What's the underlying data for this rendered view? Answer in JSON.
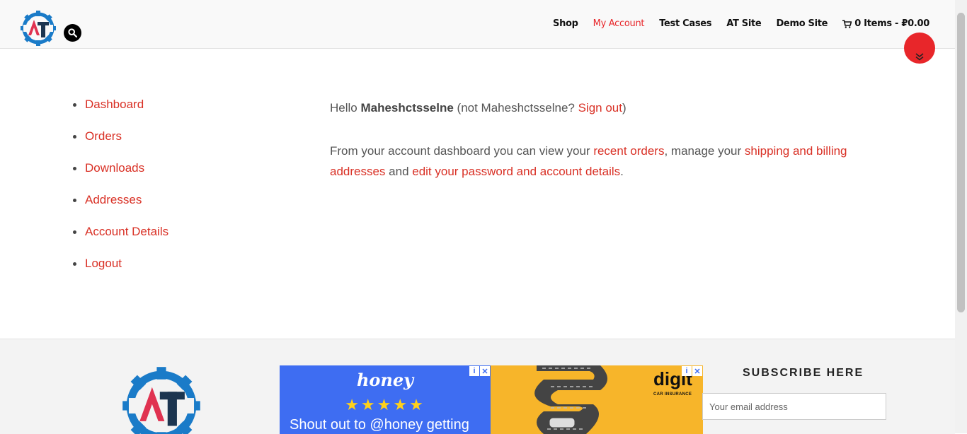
{
  "header": {
    "nav": [
      {
        "label": "Shop",
        "active": false
      },
      {
        "label": "My Account",
        "active": true
      },
      {
        "label": "Test Cases",
        "active": false
      },
      {
        "label": "AT Site",
        "active": false
      },
      {
        "label": "Demo Site",
        "active": false
      }
    ],
    "cart_label": "0 Items - ₽0.00"
  },
  "account_nav": {
    "items": [
      "Dashboard",
      "Orders",
      "Downloads",
      "Addresses",
      "Account Details",
      "Logout"
    ]
  },
  "dashboard": {
    "hello_prefix": "Hello ",
    "username": "Maheshctsselne",
    "not_prefix": " (not Maheshctsselne? ",
    "sign_out": "Sign out",
    "close_paren": ")",
    "intro": "From your account dashboard you can view your ",
    "recent_orders": "recent orders",
    "manage": ", manage your ",
    "shipping_billing": "shipping and billing addresses",
    "and": " and ",
    "edit_account": "edit your password and account details",
    "period": "."
  },
  "footer": {
    "ad1": {
      "brand": "honey",
      "stars": "★★★★★",
      "tagline": "Shout out to @honey getting"
    },
    "ad2": {
      "brand": "digit",
      "sub": "CAR INSURANCE"
    },
    "subscribe_title": "SUBSCRIBE HERE",
    "email_placeholder": "Your email address"
  },
  "colors": {
    "accent": "#e8262a",
    "link": "#d93025",
    "brand_blue": "#1a7bc8",
    "brand_navy": "#1c3550"
  }
}
